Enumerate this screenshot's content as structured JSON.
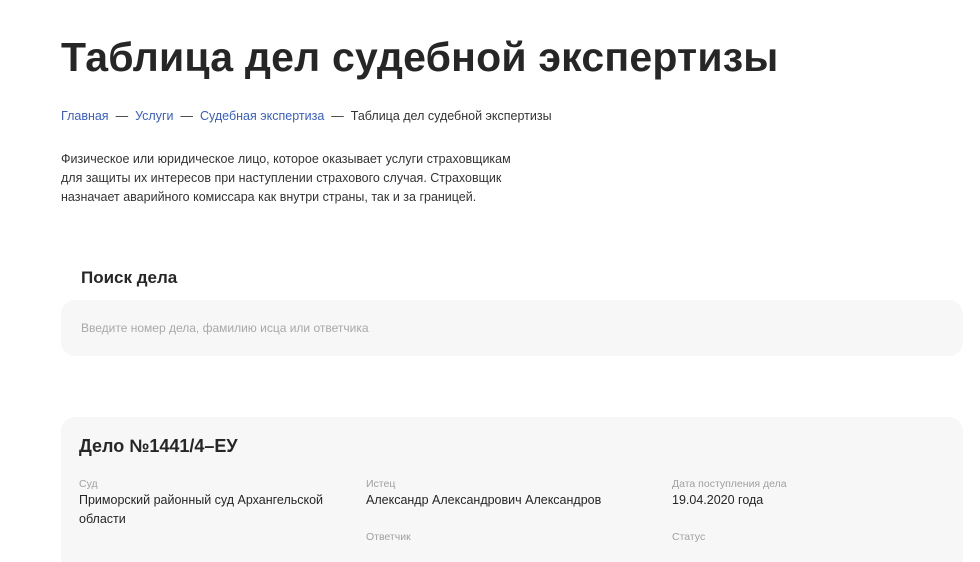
{
  "page": {
    "title": "Таблица дел судебной экспертизы"
  },
  "breadcrumb": {
    "items": [
      {
        "label": "Главная"
      },
      {
        "label": "Услуги"
      },
      {
        "label": "Судебная экспертиза"
      }
    ],
    "separator": "—",
    "current": "Таблица дел судебной экспертизы"
  },
  "description": {
    "text": "Физическое или юридическое лицо, которое оказывает услуги страховщикам для защиты их интересов при наступлении страхового случая. Страховщик назначает аварийного комиссара как внутри страны, так и за границей."
  },
  "search": {
    "heading": "Поиск дела",
    "placeholder": "Введите номер дела, фамилию исца или ответчика",
    "value": ""
  },
  "case": {
    "title": "Дело №1441/4–ЕУ",
    "court_label": "Суд",
    "court_value": "Приморский районный суд Архангельской области",
    "plaintiff_label": "Истец",
    "plaintiff_value": "Александр Александрович Александров",
    "date_label": "Дата поступления дела",
    "date_value": "19.04.2020 года",
    "defendant_label": "Ответчик",
    "status_label": "Статус"
  }
}
